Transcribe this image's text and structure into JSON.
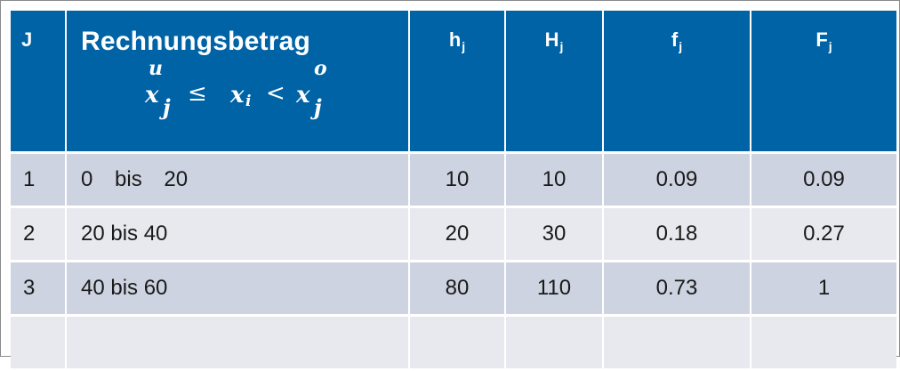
{
  "table": {
    "headers": {
      "j": "J",
      "range_title": "Rechnungsbetrag",
      "h": "h",
      "H": "H",
      "f": "f",
      "F": "F",
      "sub": "j"
    },
    "formula": {
      "x_lower": "x",
      "sup_u": "u",
      "sub_j_1": "j",
      "leq": "≤",
      "x_i": "x",
      "sub_i": "i",
      "lt": "<",
      "x_upper": "x",
      "sup_o": "o",
      "sub_j_2": "j"
    },
    "rows": [
      {
        "j": "1",
        "range": "0 bis 20",
        "h": "10",
        "H": "10",
        "f": "0.09",
        "F": "0.09"
      },
      {
        "j": "2",
        "range": "20 bis 40",
        "h": "20",
        "H": "30",
        "f": "0.18",
        "F": "0.27"
      },
      {
        "j": "3",
        "range": "40 bis 60",
        "h": "80",
        "H": "110",
        "f": "0.73",
        "F": "1"
      },
      {
        "j": "",
        "range": "",
        "h": "",
        "H": "",
        "f": "",
        "F": ""
      }
    ]
  }
}
